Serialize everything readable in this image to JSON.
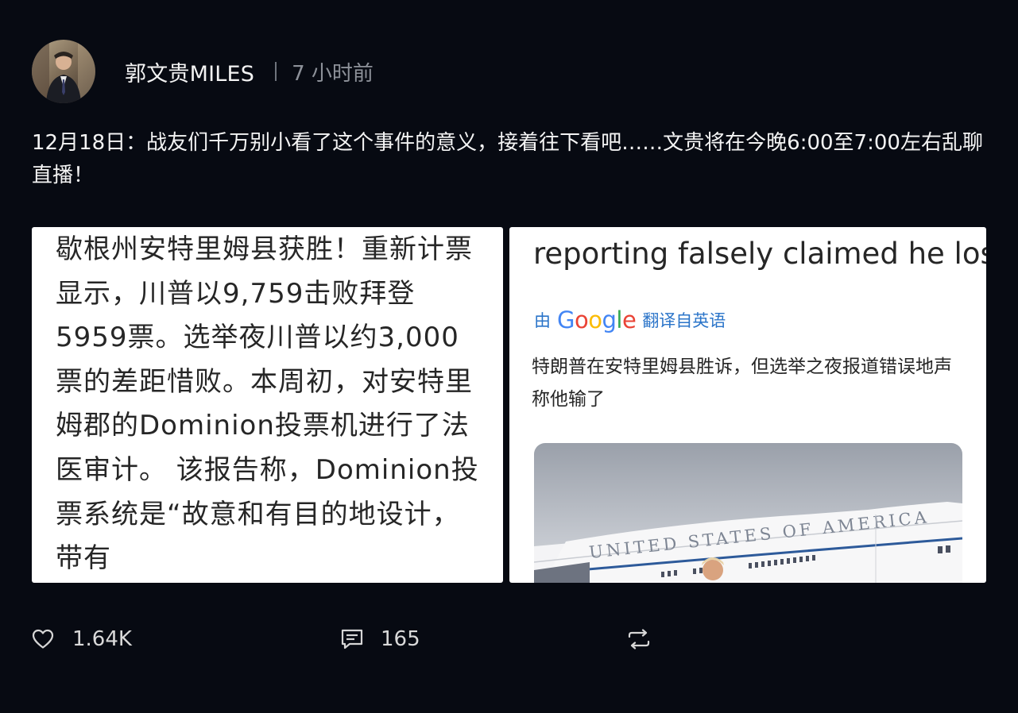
{
  "post": {
    "author": "郭文贵MILES",
    "time": "7 小时前",
    "text": "12月18日：战友们千万别小看了这个事件的意义，接着往下看吧……文贵将在今晚6:00至7:00左右乱聊直播！"
  },
  "image_left": {
    "text": "歇根州安特里姆县获胜！重新计票显示，川普以9,759击败拜登5959票。选举夜川普以约3,000票的差距惜败。本周初，对安特里姆郡的Dominion投票机进行了法医审计。 该报告称，Dominion投票系统是“故意和有目的地设计，带有"
  },
  "image_right": {
    "headline": "reporting falsely claimed he lost",
    "translated_by_prefix": "由",
    "google_letters": [
      "G",
      "o",
      "o",
      "g",
      "l",
      "e"
    ],
    "translated_by_suffix": "翻译自英语",
    "translation": "特朗普在安特里姆县胜诉，但选举之夜报道错误地声称他输了",
    "plane_text": "UNITED STATES OF AMERICA"
  },
  "actions": {
    "likes": "1.64K",
    "comments": "165"
  },
  "colors": {
    "background": "#070a12",
    "google": [
      "#4285F4",
      "#EA4335",
      "#FBBC05",
      "#4285F4",
      "#34A853",
      "#EA4335"
    ]
  },
  "icons": [
    "heart-icon",
    "comment-icon",
    "repost-icon"
  ]
}
